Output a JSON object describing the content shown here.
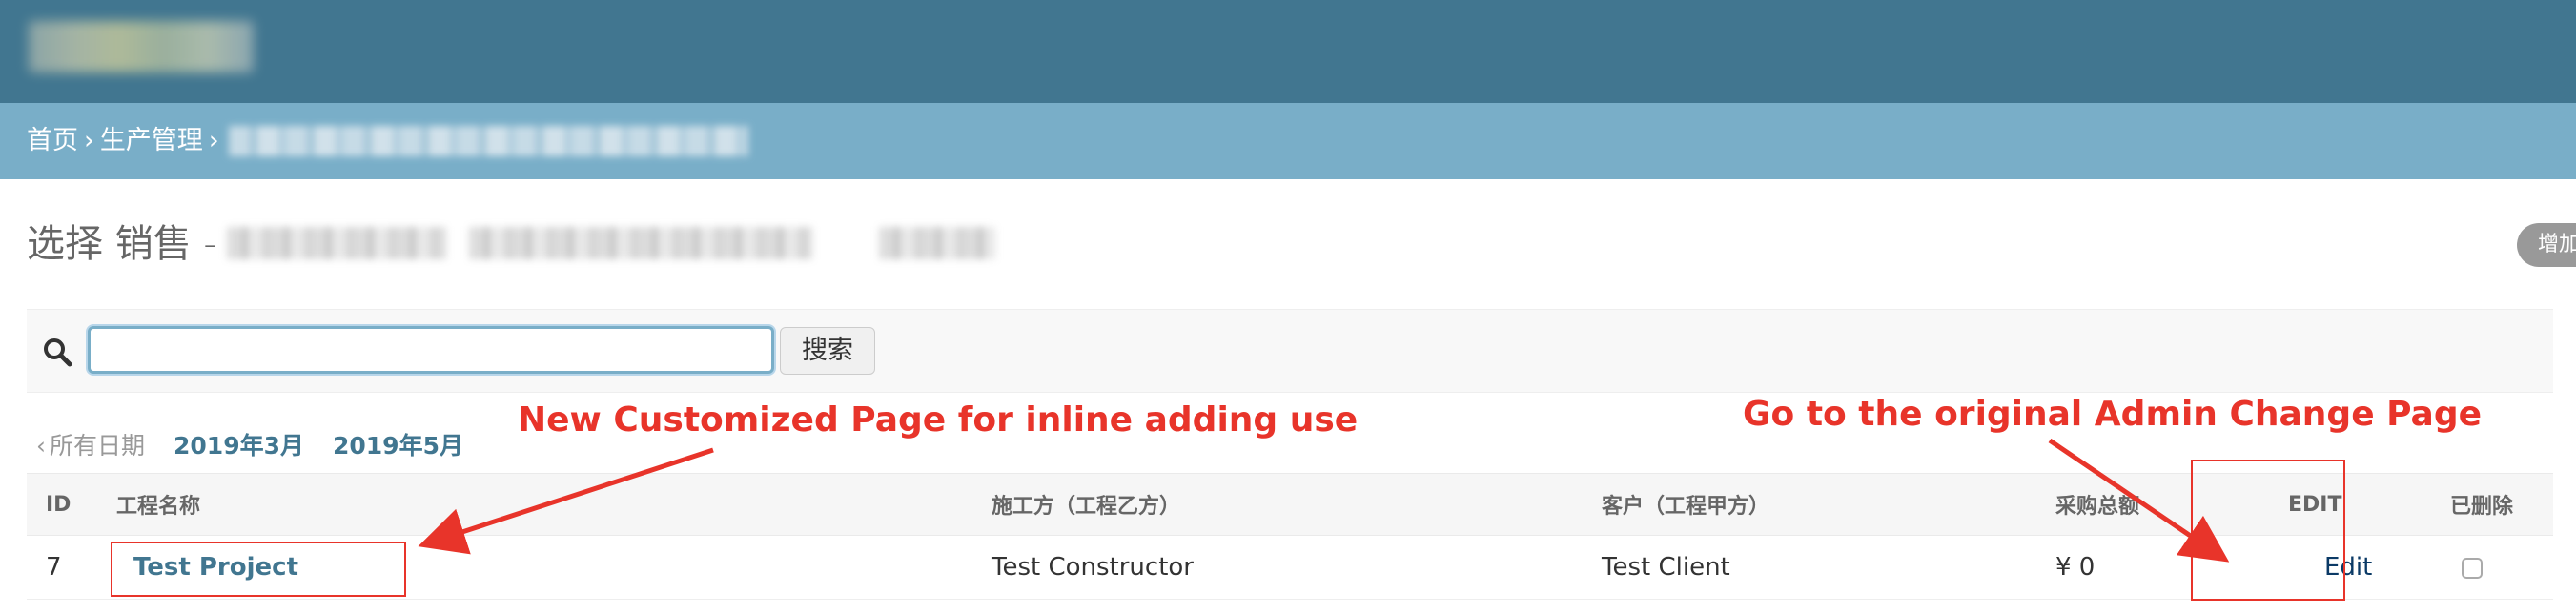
{
  "header": {
    "site_name_blurred": true
  },
  "breadcrumbs": {
    "home": "首页",
    "section": "生产管理",
    "separator": "›"
  },
  "page": {
    "title": "选择 销售 -",
    "add_button": "增加"
  },
  "search": {
    "placeholder": "",
    "value": "",
    "button": "搜索"
  },
  "date_hierarchy": {
    "back": "所有日期",
    "back_chevron": "‹",
    "dates": [
      "2019年3月",
      "2019年5月"
    ]
  },
  "table": {
    "headers": [
      "ID",
      "工程名称",
      "施工方（工程乙方）",
      "客户（工程甲方）",
      "采购总额",
      "EDIT",
      "已删除"
    ],
    "rows": [
      {
        "id": "7",
        "name": "Test Project",
        "constructor": "Test Constructor",
        "client": "Test Client",
        "total": "¥ 0",
        "edit": "Edit",
        "deleted": false
      }
    ]
  },
  "annotations": {
    "left_text": "New Customized Page for inline adding use",
    "right_text": "Go to the original Admin Change Page",
    "color": "#e8342a"
  },
  "colors": {
    "header": "#417690",
    "breadcrumbs": "#79aec8",
    "link": "#417690"
  }
}
